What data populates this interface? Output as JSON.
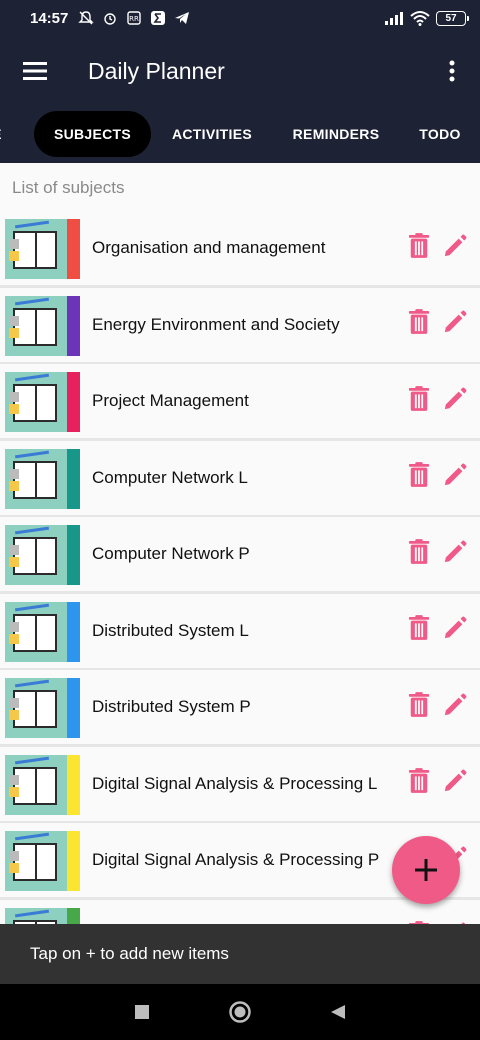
{
  "status_bar": {
    "time": "14:57",
    "battery": "57"
  },
  "app_bar": {
    "title": "Daily Planner"
  },
  "tabs": [
    {
      "label": "ME",
      "active": false
    },
    {
      "label": "SUBJECTS",
      "active": true
    },
    {
      "label": "ACTIVITIES",
      "active": false
    },
    {
      "label": "REMINDERS",
      "active": false
    },
    {
      "label": "TODO",
      "active": false
    }
  ],
  "list": {
    "header": "List of subjects",
    "subjects": [
      {
        "name": "Organisation and management",
        "color": "#f04e43"
      },
      {
        "name": "Energy Environment and Society",
        "color": "#6c35b9"
      },
      {
        "name": "Project Management",
        "color": "#e8205e"
      },
      {
        "name": "Computer Network L",
        "color": "#17978a"
      },
      {
        "name": "Computer Network P",
        "color": "#17978a"
      },
      {
        "name": "Distributed System L",
        "color": "#2d95ee"
      },
      {
        "name": "Distributed System P",
        "color": "#2d95ee"
      },
      {
        "name": "Digital Signal Analysis & Processing L",
        "color": "#fbe531"
      },
      {
        "name": "Digital Signal Analysis & Processing P",
        "color": "#fbe531"
      },
      {
        "name": "",
        "color": "#46a849"
      }
    ]
  },
  "colors": {
    "accent": "#f05a87",
    "primary_dark": "#1e2235"
  },
  "fab": {
    "icon": "plus-icon"
  },
  "snackbar": {
    "message": "Tap on + to add new items"
  }
}
